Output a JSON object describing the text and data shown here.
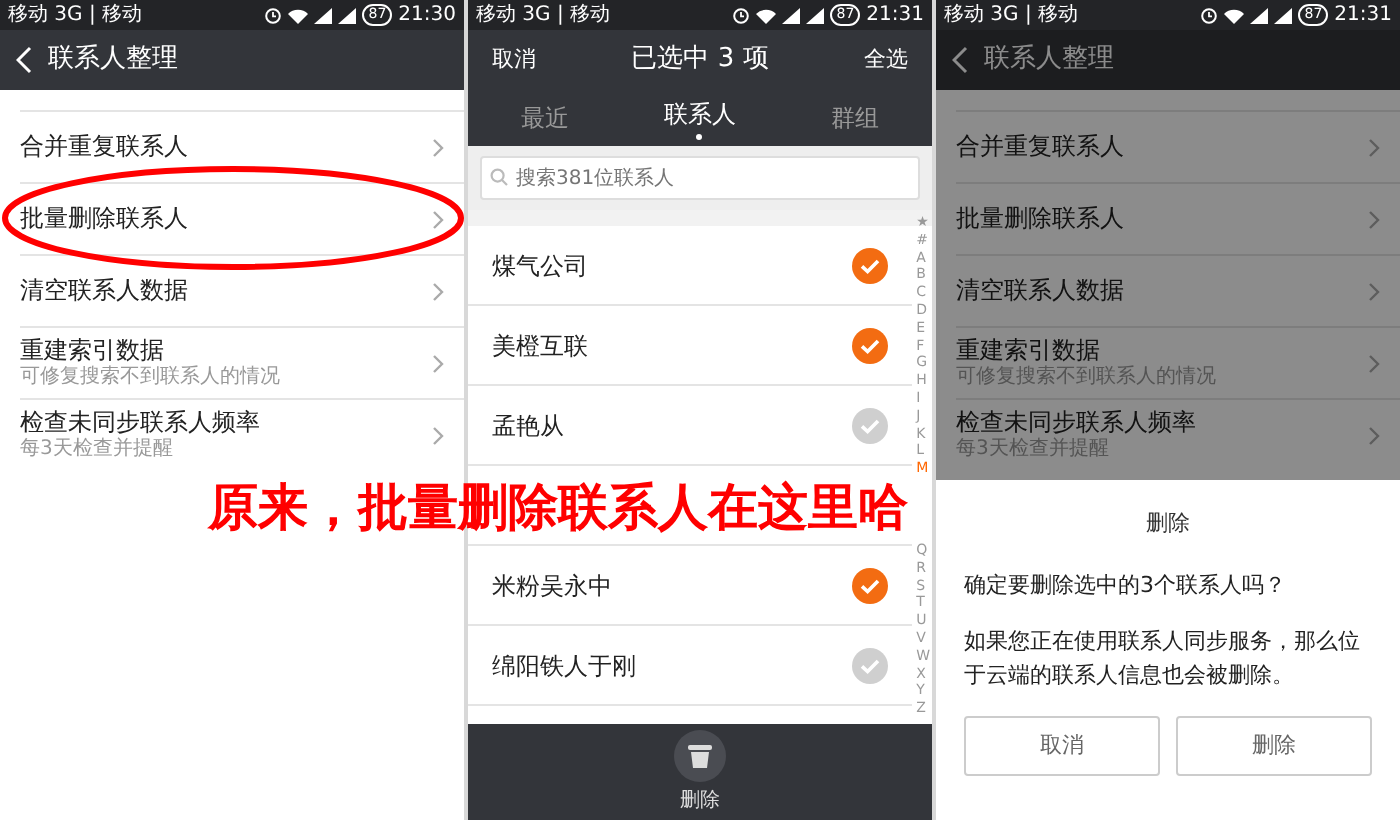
{
  "panels": [
    {
      "kind": "settings",
      "status": {
        "carrier": "移动 3G | 移动",
        "battery": "87",
        "time": "21:30"
      },
      "title": "联系人整理",
      "dimmed": false,
      "items": [
        {
          "label": "合并重复联系人",
          "circled": false
        },
        {
          "label": "批量删除联系人",
          "circled": true
        },
        {
          "label": "清空联系人数据",
          "circled": false
        },
        {
          "label": "重建索引数据",
          "sub": "可修复搜索不到联系人的情况",
          "circled": false
        },
        {
          "label": "检查未同步联系人频率",
          "sub": "每3天检查并提醒",
          "circled": false
        }
      ]
    },
    {
      "kind": "picker",
      "status": {
        "carrier": "移动 3G | 移动",
        "battery": "87",
        "time": "21:31"
      },
      "cancel": "取消",
      "title": "已选中 3 项",
      "select_all": "全选",
      "tabs": [
        {
          "label": "最近",
          "selected": false
        },
        {
          "label": "联系人",
          "selected": true
        },
        {
          "label": "群组",
          "selected": false
        }
      ],
      "search": {
        "placeholder": "搜索381位联系人"
      },
      "contacts": [
        {
          "kind": "contact",
          "name": "煤气公司",
          "selected": true
        },
        {
          "kind": "contact",
          "name": "美橙互联",
          "selected": true
        },
        {
          "kind": "contact",
          "name": "孟艳从",
          "selected": false
        },
        {
          "kind": "covered"
        },
        {
          "kind": "contact",
          "name": "米粉吴永中",
          "selected": true
        },
        {
          "kind": "contact",
          "name": "绵阳铁人于刚",
          "selected": false
        }
      ],
      "index": [
        {
          "label": "★",
          "selected": false
        },
        {
          "label": "#",
          "selected": false
        },
        {
          "label": "A",
          "selected": false
        },
        {
          "label": "B",
          "selected": false
        },
        {
          "label": "C",
          "selected": false
        },
        {
          "label": "D",
          "selected": false
        },
        {
          "label": "E",
          "selected": false
        },
        {
          "label": "F",
          "selected": false
        },
        {
          "label": "G",
          "selected": false
        },
        {
          "label": "H",
          "selected": false
        },
        {
          "label": "I",
          "selected": false
        },
        {
          "label": "J",
          "selected": false
        },
        {
          "label": "K",
          "selected": false
        },
        {
          "label": "L",
          "selected": false
        },
        {
          "label": "M",
          "selected": true
        },
        {
          "kind": "covered"
        },
        {
          "label": "Q",
          "selected": false
        },
        {
          "label": "R",
          "selected": false
        },
        {
          "label": "S",
          "selected": false
        },
        {
          "label": "T",
          "selected": false
        },
        {
          "label": "U",
          "selected": false
        },
        {
          "label": "V",
          "selected": false
        },
        {
          "label": "W",
          "selected": false
        },
        {
          "label": "X",
          "selected": false
        },
        {
          "label": "Y",
          "selected": false
        },
        {
          "label": "Z",
          "selected": false
        }
      ],
      "delete_label": "删除"
    },
    {
      "kind": "settings",
      "status": {
        "carrier": "移动 3G | 移动",
        "battery": "87",
        "time": "21:31"
      },
      "title": "联系人整理",
      "dimmed": true,
      "items": [
        {
          "label": "合并重复联系人",
          "circled": false
        },
        {
          "label": "批量删除联系人",
          "circled": false
        },
        {
          "label": "清空联系人数据",
          "circled": false
        },
        {
          "label": "重建索引数据",
          "sub": "可修复搜索不到联系人的情况",
          "circled": false
        },
        {
          "label": "检查未同步联系人频率",
          "sub": "每3天检查并提醒",
          "circled": false
        }
      ],
      "dialog": {
        "title": "删除",
        "message": "确定要删除选中的3个联系人吗？",
        "note": "如果您正在使用联系人同步服务，那么位于云端的联系人信息也会被删除。",
        "buttons": [
          "取消",
          "删除"
        ]
      }
    }
  ],
  "caption": "原来，批量删除联系人在这里哈"
}
